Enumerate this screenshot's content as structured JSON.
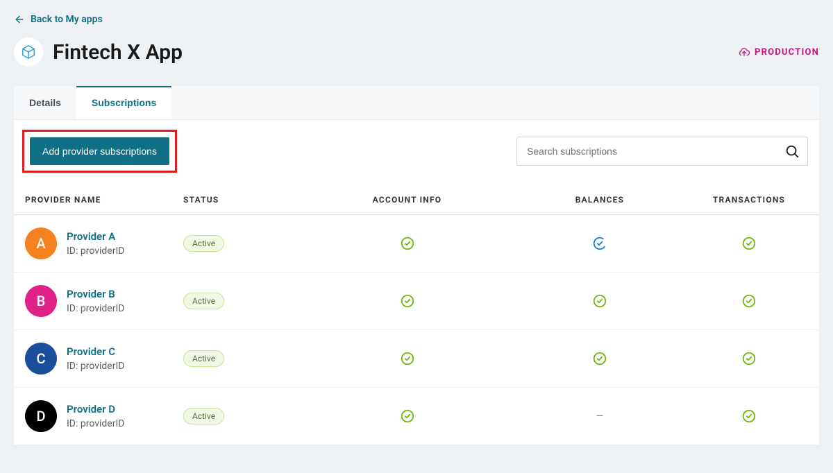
{
  "nav": {
    "back_label": "Back to My apps"
  },
  "header": {
    "title": "Fintech X App",
    "env_label": "PRODUCTION"
  },
  "tabs": [
    {
      "label": "Details",
      "active": false
    },
    {
      "label": "Subscriptions",
      "active": true
    }
  ],
  "toolbar": {
    "add_button": "Add provider subscriptions",
    "search_placeholder": "Search subscriptions"
  },
  "columns": {
    "provider": "PROVIDER NAME",
    "status": "STATUS",
    "account_info": "ACCOUNT INFO",
    "balances": "BALANCES",
    "transactions": "TRANSACTIONS"
  },
  "status_values": {
    "active": "Active"
  },
  "id_prefix": "ID: ",
  "rows": [
    {
      "letter": "A",
      "avatar_color": "#f58220",
      "name": "Provider A",
      "id": "providerID",
      "status": "active",
      "account_info": "check",
      "balances": "progress",
      "transactions": "check"
    },
    {
      "letter": "B",
      "avatar_color": "#e0218a",
      "name": "Provider B",
      "id": "providerID",
      "status": "active",
      "account_info": "check",
      "balances": "check",
      "transactions": "check"
    },
    {
      "letter": "C",
      "avatar_color": "#1b4f9c",
      "name": "Provider C",
      "id": "providerID",
      "status": "active",
      "account_info": "check",
      "balances": "check",
      "transactions": "check"
    },
    {
      "letter": "D",
      "avatar_color": "#000000",
      "name": "Provider D",
      "id": "providerID",
      "status": "active",
      "account_info": "check",
      "balances": "dash",
      "transactions": "check"
    }
  ]
}
